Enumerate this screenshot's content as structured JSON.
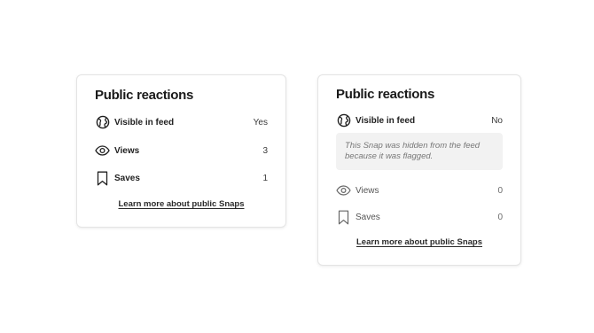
{
  "cards": [
    {
      "title": "Public reactions",
      "rows": [
        {
          "icon": "globe-icon",
          "label": "Visible in feed",
          "value": "Yes"
        },
        {
          "icon": "eye-icon",
          "label": "Views",
          "value": "3"
        },
        {
          "icon": "bookmark-icon",
          "label": "Saves",
          "value": "1"
        }
      ],
      "link": "Learn more about public Snaps"
    },
    {
      "title": "Public reactions",
      "rows": [
        {
          "icon": "globe-icon",
          "label": "Visible in feed",
          "value": "No"
        },
        {
          "icon": "eye-icon",
          "label": "Views",
          "value": "0"
        },
        {
          "icon": "bookmark-icon",
          "label": "Saves",
          "value": "0"
        }
      ],
      "notice": "This Snap was hidden from the feed because it was flagged.",
      "link": "Learn more about public Snaps"
    }
  ]
}
